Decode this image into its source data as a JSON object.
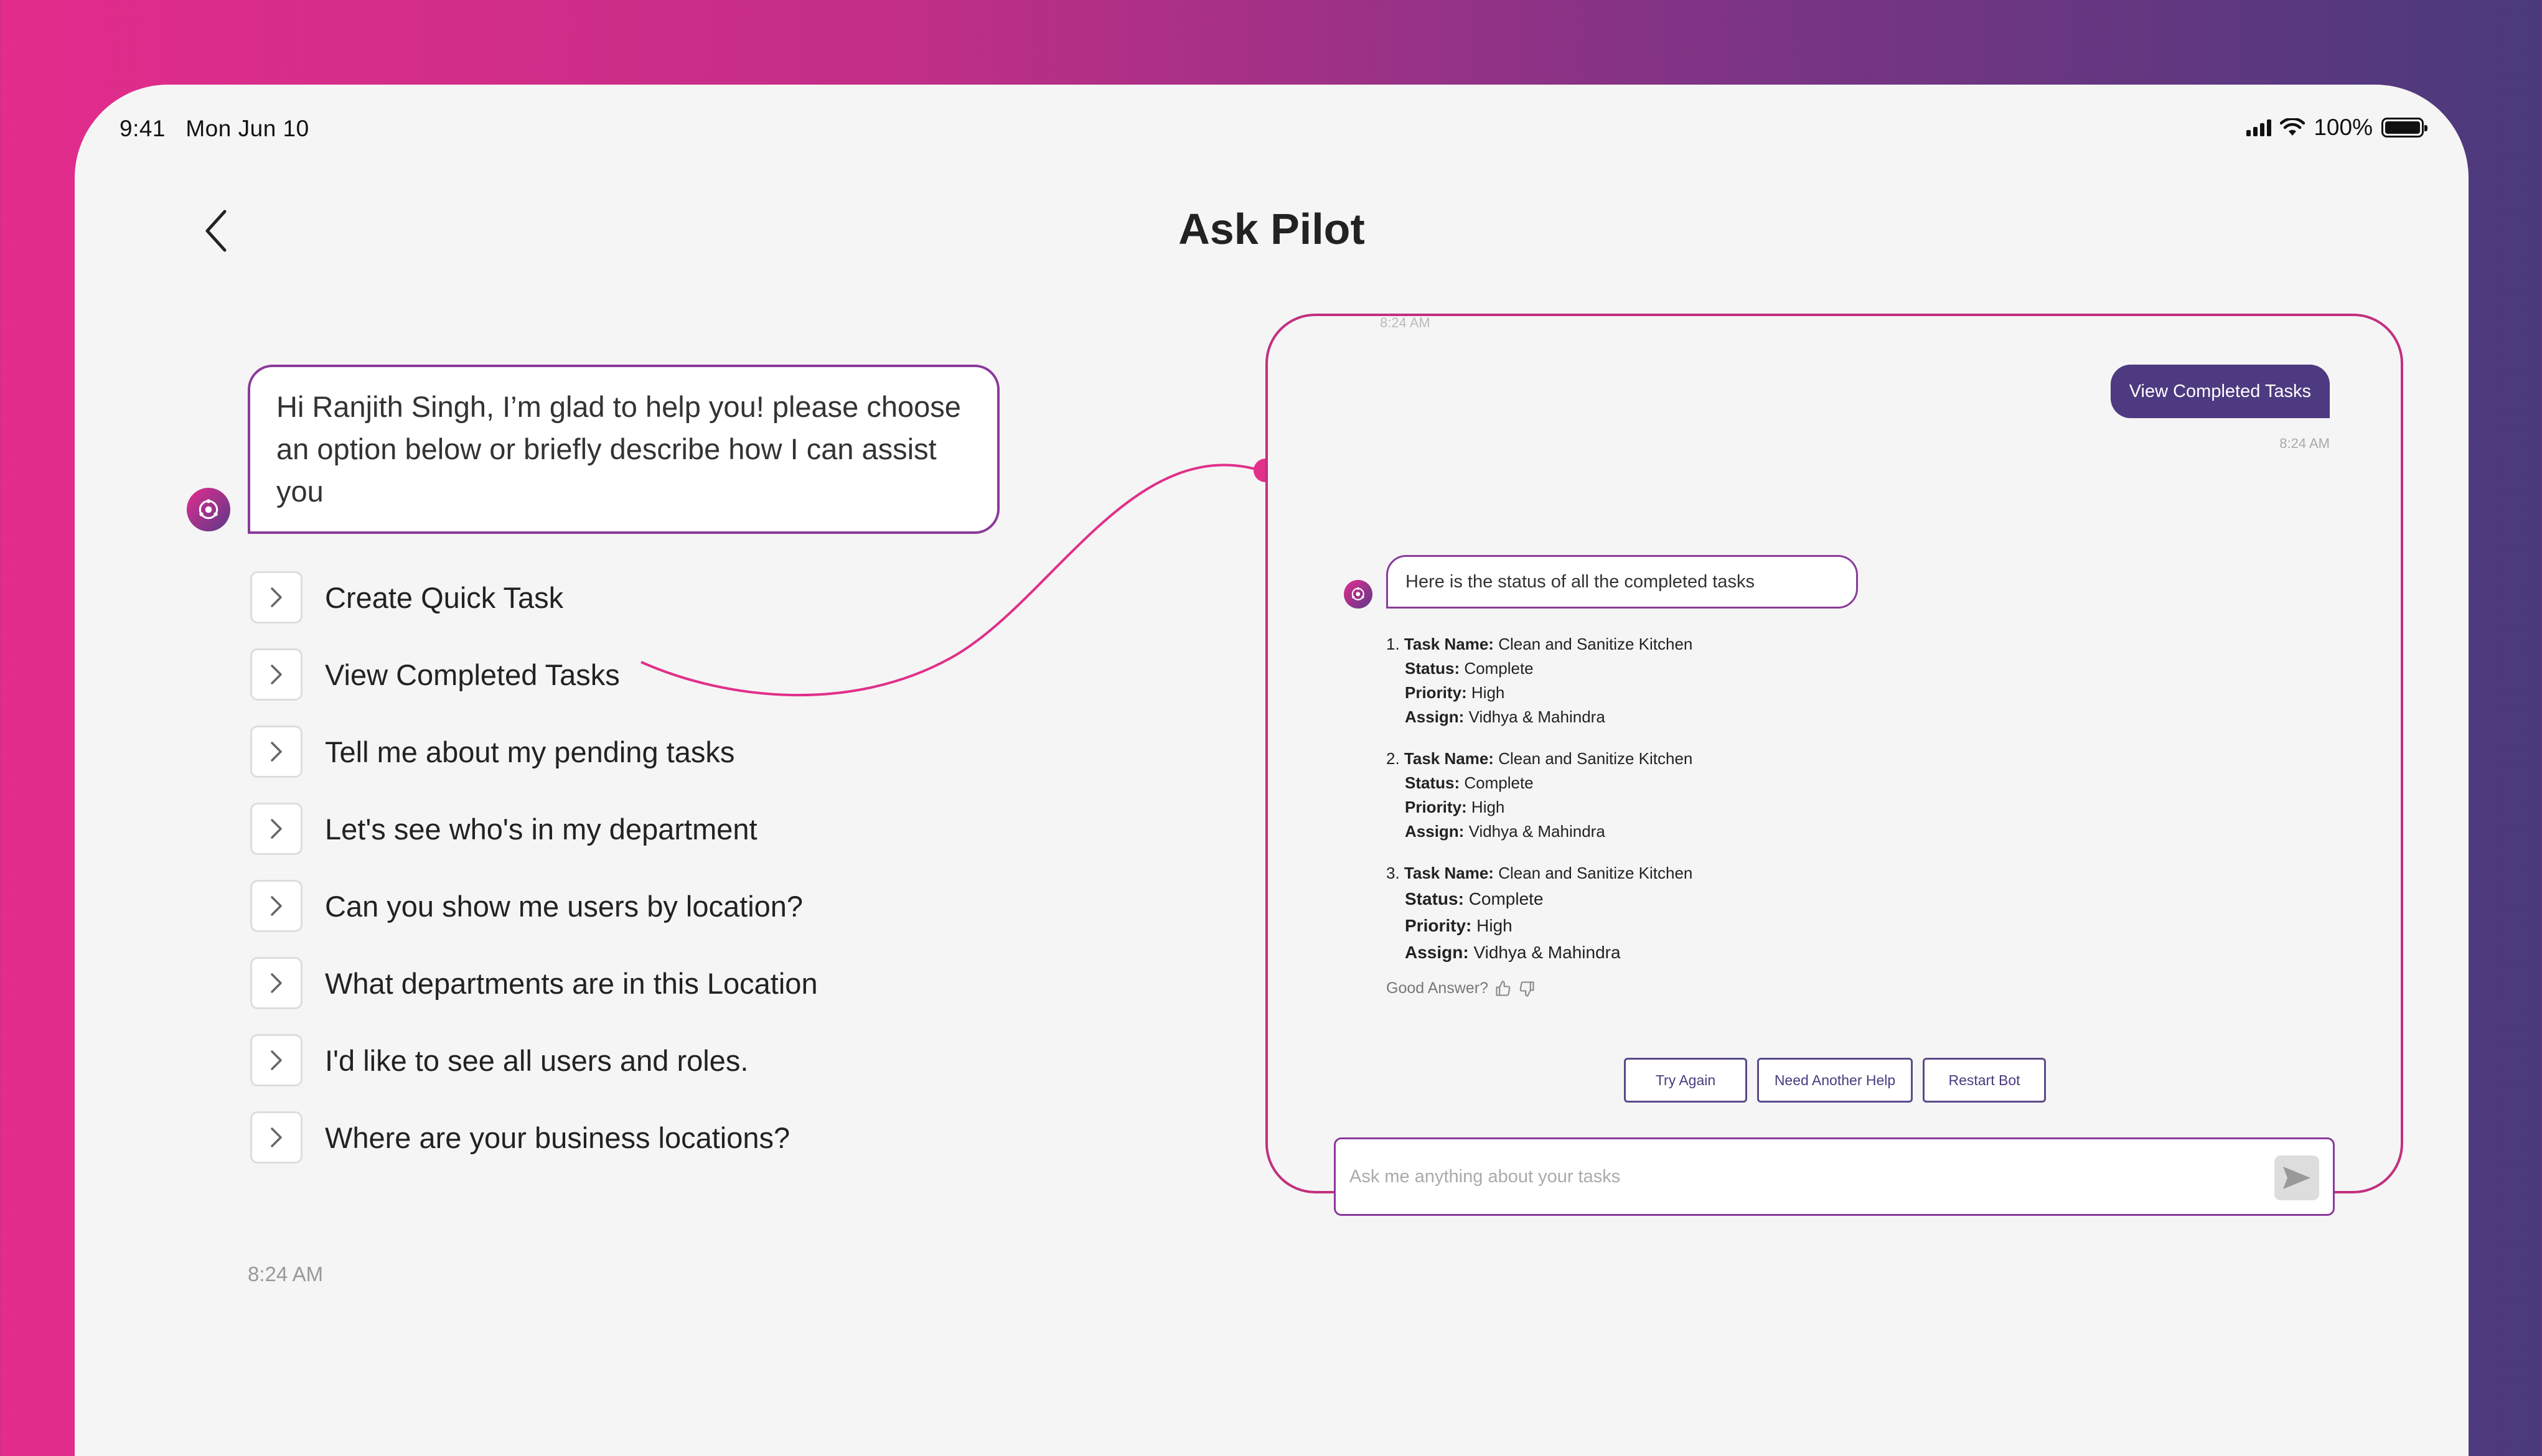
{
  "status_bar": {
    "time": "9:41",
    "date": "Mon Jun 10",
    "battery": "100%"
  },
  "header": {
    "title": "Ask Pilot"
  },
  "greeting": {
    "text": "Hi Ranjith Singh, I’m glad to help you! please choose an option below or briefly describe how I can assist you",
    "time": "8:24 AM"
  },
  "options": [
    {
      "label": "Create Quick Task"
    },
    {
      "label": "View Completed Tasks"
    },
    {
      "label": "Tell me about my pending tasks"
    },
    {
      "label": "Let's see who's in my department"
    },
    {
      "label": "Can you show me users by location?"
    },
    {
      "label": "What departments are in this Location"
    },
    {
      "label": "I'd like to see all users and roles."
    },
    {
      "label": "Where are your business locations?"
    }
  ],
  "panel": {
    "top_time": "8:24 AM",
    "user_message": "View Completed Tasks",
    "user_time": "8:24 AM",
    "bot_message": "Here is the status of all the completed tasks",
    "labels": {
      "task_name": "Task Name:",
      "status": "Status:",
      "priority": "Priority:",
      "assign": "Assign:"
    },
    "tasks": [
      {
        "num": "1.",
        "name": "Clean and Sanitize Kitchen",
        "status": "Complete",
        "priority": "High",
        "assign": "Vidhya & Mahindra"
      },
      {
        "num": "2.",
        "name": "Clean and Sanitize Kitchen",
        "status": "Complete",
        "priority": "High",
        "assign": "Vidhya & Mahindra"
      },
      {
        "num": "3.",
        "name": "Clean and Sanitize Kitchen",
        "status": "Complete",
        "priority": "High",
        "assign": "Vidhya & Mahindra"
      }
    ],
    "feedback_label": "Good Answer?",
    "actions": {
      "try_again": "Try Again",
      "need_help": "Need Another Help",
      "restart": "Restart Bot"
    },
    "input_placeholder": "Ask me anything about your tasks"
  },
  "colors": {
    "accent_pink": "#e32c8c",
    "accent_purple": "#4e3a80",
    "background": "#f5f5f5"
  }
}
